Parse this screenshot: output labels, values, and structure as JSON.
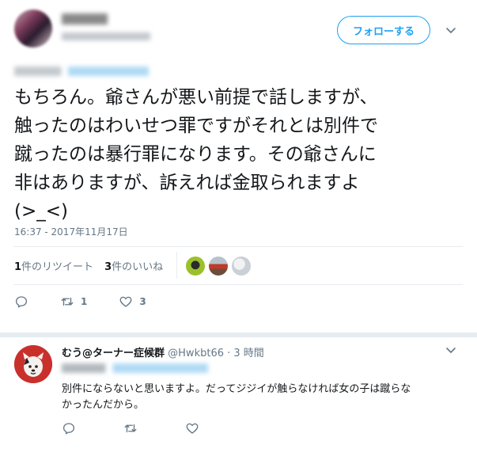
{
  "main_tweet": {
    "follow_label": "フォローする",
    "text_lines": [
      "もちろん。爺さんが悪い前提で話しますが、",
      "触ったのはわいせつ罪ですがそれとは別件で",
      "蹴ったのは暴行罪になります。その爺さんに",
      "非はありますが、訴えれば金取られますよ",
      "(>_<)"
    ],
    "timestamp": "16:37 - 2017年11月17日",
    "retweet_count_label": "1",
    "retweet_suffix": "件のリツイート",
    "like_count_label": "3",
    "like_suffix": "件のいいね",
    "action_retweets": "1",
    "action_likes": "3"
  },
  "reply": {
    "name": "むう@ターナー症候群",
    "handle": "@Hwkbt66",
    "time": "· 3 時間",
    "text_lines": [
      "別件にならないと思いますよ。だってジジイが触らなければ女の子は蹴らな",
      "かったんだから。"
    ]
  },
  "colors": {
    "accent": "#1da1f2",
    "secondary_text": "#657786",
    "divider": "#e6ecf0"
  },
  "icons": [
    "reply-icon",
    "retweet-icon",
    "like-icon",
    "chevron-down-icon"
  ]
}
